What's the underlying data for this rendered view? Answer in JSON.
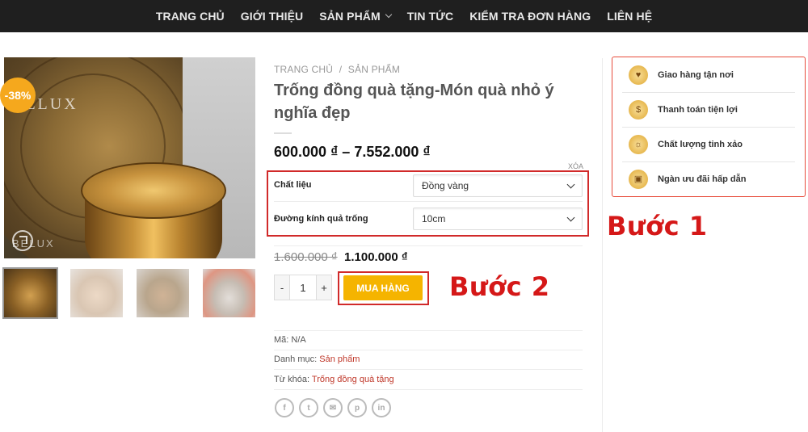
{
  "nav": {
    "items": [
      "TRANG CHỦ",
      "GIỚI THIỆU",
      "SẢN PHẨM",
      "TIN TỨC",
      "KIỂM TRA ĐƠN HÀNG",
      "LIÊN HỆ"
    ]
  },
  "product": {
    "sale_badge": "-38%",
    "brand_watermark": "BELUX",
    "breadcrumb": [
      "TRANG CHỦ",
      "/",
      "SẢN PHẨM"
    ],
    "title": "Trống đồng quà tặng-Món quà nhỏ ý nghĩa đẹp",
    "price_range": "600.000 ₫ – 7.552.000 ₫",
    "clear_label": "XÓA",
    "variations": [
      {
        "label": "Chất liệu",
        "value": "Đồng vàng"
      },
      {
        "label": "Đường kính quả trống",
        "value": "10cm"
      }
    ],
    "old_price": "1.600.000 ₫",
    "new_price": "1.100.000 ₫",
    "qty": {
      "minus": "-",
      "value": "1",
      "plus": "+"
    },
    "buy_label": "MUA HÀNG",
    "meta": {
      "sku_label": "Mã:",
      "sku_value": "N/A",
      "category_label": "Danh mục:",
      "category_value": "Sản phẩm",
      "tag_label": "Từ khóa:",
      "tag_value": "Trống đồng quà tặng"
    }
  },
  "annotations": {
    "step1": "Bước 1",
    "step2": "Bước 2"
  },
  "sidebar": {
    "items": [
      {
        "label": "Giao hàng tận nơi",
        "icon": "delivery-icon"
      },
      {
        "label": "Thanh toán tiện lợi",
        "icon": "payment-icon"
      },
      {
        "label": "Chất lượng tinh xảo",
        "icon": "quality-icon"
      },
      {
        "label": "Ngàn ưu đãi hấp dẫn",
        "icon": "gift-icon"
      }
    ]
  },
  "colors": {
    "nav_bg": "#1f1f1f",
    "accent_orange": "#f5b400",
    "annotation_red": "#d51818",
    "link_red": "#c0392b"
  }
}
